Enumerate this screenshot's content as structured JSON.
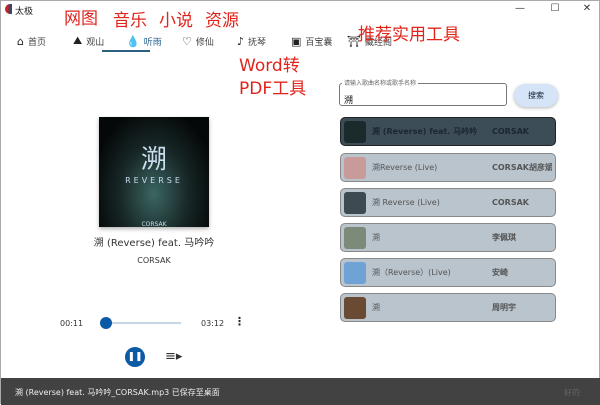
{
  "window": {
    "title": "太极",
    "minimize": "—",
    "maximize": "☐",
    "close": "✕"
  },
  "tabs": [
    {
      "label": "首页",
      "icon": "⌂"
    },
    {
      "label": "观山",
      "icon": "⛰"
    },
    {
      "label": "听雨",
      "icon": "💧"
    },
    {
      "label": "修仙",
      "icon": "♡"
    },
    {
      "label": "抚琴",
      "icon": "♪"
    },
    {
      "label": "百宝囊",
      "icon": "▣"
    },
    {
      "label": "藏经阁",
      "icon": "⛩"
    }
  ],
  "annotations": {
    "wangtu": "网图",
    "yinyue": "音乐",
    "xiaoshuo": "小说",
    "ziyuan": "资源",
    "tools": "推荐实用工具",
    "word1": "Word转",
    "word2": "PDF工具"
  },
  "search": {
    "label": "请输入歌曲名称或歌手名称",
    "value": "溯",
    "button": "搜索"
  },
  "results": [
    {
      "name": "溯 (Reverse) feat. 马吟吟",
      "artist": "CORSAK",
      "thumb": "#1b2a2a"
    },
    {
      "name": "溯Reverse (Live)",
      "artist": "CORSAK胡彦斌",
      "thumb": "#c99a9a"
    },
    {
      "name": "溯 Reverse (Live)",
      "artist": "CORSAK",
      "thumb": "#3e4a52"
    },
    {
      "name": "溯",
      "artist": "李佩琪",
      "thumb": "#7c8a7a"
    },
    {
      "name": "溯（Reverse）(Live)",
      "artist": "安崎",
      "thumb": "#6fa3d6"
    },
    {
      "name": "溯",
      "artist": "周明宇",
      "thumb": "#6a4a33"
    }
  ],
  "player": {
    "art_title": "溯",
    "art_sub": "REVERSE",
    "art_brand": "CORSAK",
    "song": "溯 (Reverse) feat. 马吟吟",
    "artist": "CORSAK",
    "elapsed": "00:11",
    "duration": "03:12",
    "progress": 0.057
  },
  "snackbar": {
    "message": "溯 (Reverse) feat. 马吟吟_CORSAK.mp3 已保存至桌面",
    "action": "好的"
  }
}
